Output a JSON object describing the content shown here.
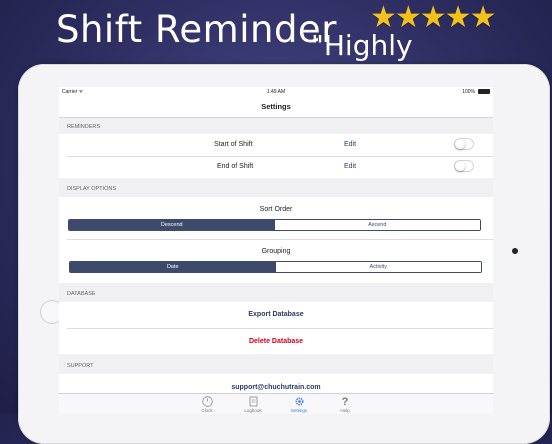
{
  "promo": {
    "title": "Shift Reminder",
    "stars": "★★★★★",
    "quote": "\"Highly recommend\""
  },
  "status_bar": {
    "carrier": "Carrier ᯤ",
    "time": "1:49 AM",
    "battery": "100%"
  },
  "nav": {
    "title": "Settings"
  },
  "reminders": {
    "header": "REMINDERS",
    "rows": [
      {
        "label": "Start of Shift",
        "action": "Edit",
        "enabled": false
      },
      {
        "label": "End of Shift",
        "action": "Edit",
        "enabled": false
      }
    ]
  },
  "display_options": {
    "header": "DISPLAY OPTIONS",
    "sort_order": {
      "label": "Sort Order",
      "options": [
        "Descend",
        "Ascend"
      ],
      "selected": "Descend"
    },
    "grouping": {
      "label": "Grouping",
      "options": [
        "Date",
        "Activity"
      ],
      "selected": "Date"
    }
  },
  "database": {
    "header": "DATABASE",
    "export_label": "Export Database",
    "delete_label": "Delete Database"
  },
  "support": {
    "header": "SUPPORT",
    "email": "support@chuchutrain.com"
  },
  "tabs": [
    {
      "label": "Clock",
      "icon": "clock-icon"
    },
    {
      "label": "Logbook",
      "icon": "logbook-icon"
    },
    {
      "label": "Settings",
      "icon": "gear-icon",
      "active": true
    },
    {
      "label": "Help",
      "icon": "help-icon"
    }
  ],
  "colors": {
    "accent": "#3e4a6b",
    "link": "#2b3a63",
    "destructive": "#d0021b",
    "tab_active": "#3a7ae0",
    "stars": "#f2c21a"
  }
}
